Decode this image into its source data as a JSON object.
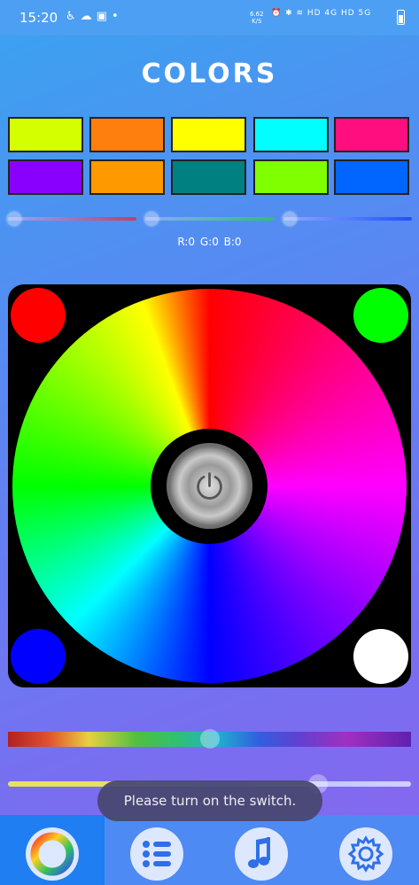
{
  "status_bar": {
    "time": "15:20",
    "left_icons": [
      "accessibility-icon",
      "weather-icon",
      "gallery-icon",
      "dot-icon"
    ],
    "net_speed_value": "6.62",
    "net_speed_unit": "K/S",
    "right_text": "⏰ ✱ ≋ HD 4G HD 5G"
  },
  "title": "COLORS",
  "swatches": [
    "#d4ff00",
    "#ff7f0e",
    "#ffff00",
    "#00ffff",
    "#ff0e7f",
    "#8a00ff",
    "#ff9900",
    "#008080",
    "#7fff00",
    "#0066ff"
  ],
  "rgb_readout": "R:0 G:0 B:0",
  "corner_colors": {
    "top_left": "#ff0000",
    "top_right": "#00ff00",
    "bottom_left": "#0000ff",
    "bottom_right": "#ffffff"
  },
  "toast": "Please turn on the switch.",
  "nav": {
    "tabs": [
      {
        "icon": "color-wheel-icon",
        "active": true
      },
      {
        "icon": "list-icon",
        "active": false
      },
      {
        "icon": "music-note-icon",
        "active": false
      },
      {
        "icon": "gear-icon",
        "active": false
      }
    ]
  },
  "colors": {
    "accent": "#1f7ef2",
    "nav_bg": "#4e8af3"
  }
}
